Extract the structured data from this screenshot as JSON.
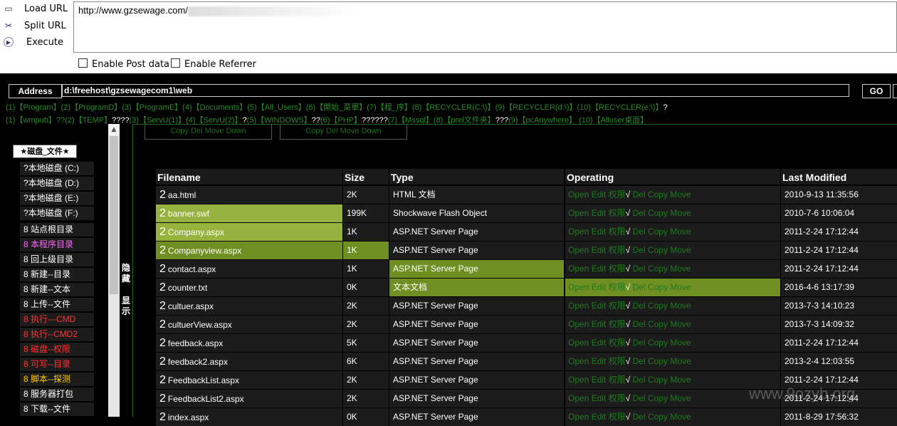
{
  "toolbar": {
    "load_url": "Load URL",
    "split_url": "Split URL",
    "execute": "Execute",
    "url": "http://www.gzsewage.com/",
    "enable_post": "Enable Post data",
    "enable_referrer": "Enable Referrer"
  },
  "address": {
    "label": "Address",
    "value": "d:\\freehost\\gzsewagecom1\\web",
    "go": "GO"
  },
  "quick_links": {
    "line1": [
      {
        "t": "(1)【Program】(2)【ProgramD】(3)【ProgramE】(4)【Documents】(5)【All_Users】(6)【開始_菜單】(7)【程_序】(8)【RECYCLER(C:\\)】(9)【RECYCLER(d:\\)】(10)【RECYCLER(e:\\)】",
        "c": "q"
      },
      {
        "t": "?",
        "c": "w"
      }
    ],
    "line2": [
      {
        "t": "(1)【wmpub】??(2)【TEMP】",
        "c": "q"
      },
      {
        "t": "????",
        "c": "w"
      },
      {
        "t": "(3)【ServU(1)】(4)【ServU(2)】",
        "c": "q"
      },
      {
        "t": "?",
        "c": "w"
      },
      {
        "t": "(5)【WINDOWS】",
        "c": "q"
      },
      {
        "t": "??",
        "c": "w"
      },
      {
        "t": "(6)【PHP】",
        "c": "q"
      },
      {
        "t": "??????",
        "c": "w"
      },
      {
        "t": "(7)【Mssql】(8)【prel文件夹】",
        "c": "q"
      },
      {
        "t": "???",
        "c": "w"
      },
      {
        "t": "(9)【pcAnywhere】 (10)【Alluser桌面】",
        "c": "q"
      }
    ]
  },
  "sidebar": {
    "header": "★磁盘_文件★",
    "drives": [
      "?本地磁盘 (C:)",
      "?本地磁盘 (D:)",
      "?本地磁盘 (E:)",
      "?本地磁盘 (F:)"
    ],
    "items": [
      {
        "label": "8 站点根目录",
        "color": "#ffffff"
      },
      {
        "label": "8 本程序目录",
        "color": "#ff66ff"
      },
      {
        "label": "8 回上级目录",
        "color": "#ffffff"
      },
      {
        "label": "8 新建--目录",
        "color": "#ffffff"
      },
      {
        "label": "8 新建--文本",
        "color": "#ffffff"
      },
      {
        "label": "8 上传--文件",
        "color": "#ffffff"
      },
      {
        "label": "8 执行---CMD",
        "color": "#ff3333"
      },
      {
        "label": "8 执行--CMD2",
        "color": "#ff3333"
      },
      {
        "label": "8 磁盘--权限",
        "color": "#ff3333"
      },
      {
        "label": "8 可写--目录",
        "color": "#ff3333"
      },
      {
        "label": "8 脚本--探测",
        "color": "#ffcc00"
      },
      {
        "label": "8 服务器打包",
        "color": "#ffffff"
      },
      {
        "label": "8 下载--文件",
        "color": "#ffffff"
      }
    ],
    "toggle_hide": "隐藏",
    "toggle_show": "显示"
  },
  "top_buttons": [
    "Copy Del Move Down",
    "Copy Del Move Down"
  ],
  "table": {
    "headers": [
      "Filename",
      "Size",
      "Type",
      "Operating",
      "Last Modified"
    ],
    "op_green": "Open Edit 权限",
    "op_check": "√",
    "op_rest": " Del Copy Move",
    "rows": [
      {
        "name": "aa.html",
        "size": "2K",
        "type": "HTML 文档",
        "date": "2010-9-13 11:35:56",
        "hl": ""
      },
      {
        "name": "banner.swf",
        "size": "199K",
        "type": "Shockwave Flash Object",
        "date": "2010-7-6 10:06:04",
        "hl": "name"
      },
      {
        "name": "Company.aspx",
        "size": "1K",
        "type": "ASP.NET Server Page",
        "date": "2011-2-24 17:12:44",
        "hl": "name"
      },
      {
        "name": "Companyview.aspx",
        "size": "1K",
        "type": "ASP.NET Server Page",
        "date": "2011-2-24 17:12:44",
        "hl": "namesize"
      },
      {
        "name": "contact.aspx",
        "size": "1K",
        "type": "ASP.NET Server Page",
        "date": "2011-2-24 17:12:44",
        "hl": "type"
      },
      {
        "name": "counter.txt",
        "size": "0K",
        "type": "文本文档",
        "date": "2016-4-6 13:17:39",
        "hl": "typeop"
      },
      {
        "name": "cultuer.aspx",
        "size": "2K",
        "type": "ASP.NET Server Page",
        "date": "2013-7-3 14:10:23",
        "hl": ""
      },
      {
        "name": "cultuerView.aspx",
        "size": "2K",
        "type": "ASP.NET Server Page",
        "date": "2013-7-3 14:09:32",
        "hl": ""
      },
      {
        "name": "feedback.aspx",
        "size": "5K",
        "type": "ASP.NET Server Page",
        "date": "2011-2-24 17:12:44",
        "hl": ""
      },
      {
        "name": "feedback2.aspx",
        "size": "6K",
        "type": "ASP.NET Server Page",
        "date": "2013-2-4 12:03:55",
        "hl": ""
      },
      {
        "name": "FeedbackList.aspx",
        "size": "2K",
        "type": "ASP.NET Server Page",
        "date": "2011-2-24 17:12:44",
        "hl": ""
      },
      {
        "name": "FeedbackList2.aspx",
        "size": "2K",
        "type": "ASP.NET Server Page",
        "date": "2011-2-24 17:12:44",
        "hl": ""
      },
      {
        "name": "index.aspx",
        "size": "0K",
        "type": "ASP.NET Server Page",
        "date": "2011-8-29 17:56:32",
        "hl": ""
      }
    ]
  },
  "watermark": "www.9ozyb.org"
}
